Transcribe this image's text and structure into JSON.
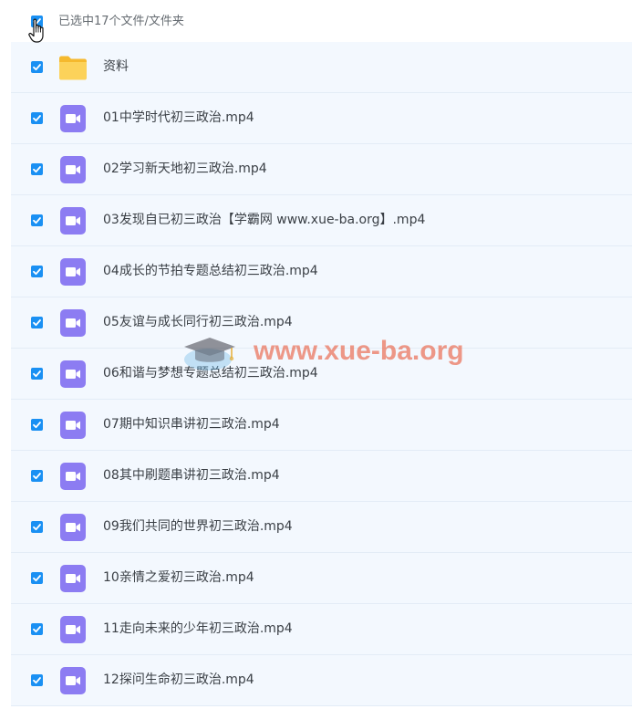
{
  "header": {
    "selection_label": "已选中17个文件/文件夹"
  },
  "colors": {
    "checkbox": "#1a90f3",
    "row_background": "#f3f8fe",
    "folder": "#fcd25a",
    "video_icon": "#8c7cf2"
  },
  "files": [
    {
      "name": "资料",
      "icon": "folder-icon"
    },
    {
      "name": "01中学时代初三政治.mp4",
      "icon": "video-file-icon"
    },
    {
      "name": "02学习新天地初三政治.mp4",
      "icon": "video-file-icon"
    },
    {
      "name": "03发现自已初三政治【学霸网 www.xue-ba.org】.mp4",
      "icon": "video-file-icon"
    },
    {
      "name": "04成长的节拍专题总结初三政治.mp4",
      "icon": "video-file-icon"
    },
    {
      "name": "05友谊与成长同行初三政治.mp4",
      "icon": "video-file-icon"
    },
    {
      "name": "06和谐与梦想专题总结初三政治.mp4",
      "icon": "video-file-icon"
    },
    {
      "name": "07期中知识串讲初三政治.mp4",
      "icon": "video-file-icon"
    },
    {
      "name": "08其中刷题串讲初三政治.mp4",
      "icon": "video-file-icon"
    },
    {
      "name": "09我们共同的世界初三政治.mp4",
      "icon": "video-file-icon"
    },
    {
      "name": "10亲情之爱初三政治.mp4",
      "icon": "video-file-icon"
    },
    {
      "name": "11走向未来的少年初三政治.mp4",
      "icon": "video-file-icon"
    },
    {
      "name": "12探问生命初三政治.mp4",
      "icon": "video-file-icon"
    }
  ],
  "watermark": {
    "text": "www.xue-ba.org"
  }
}
